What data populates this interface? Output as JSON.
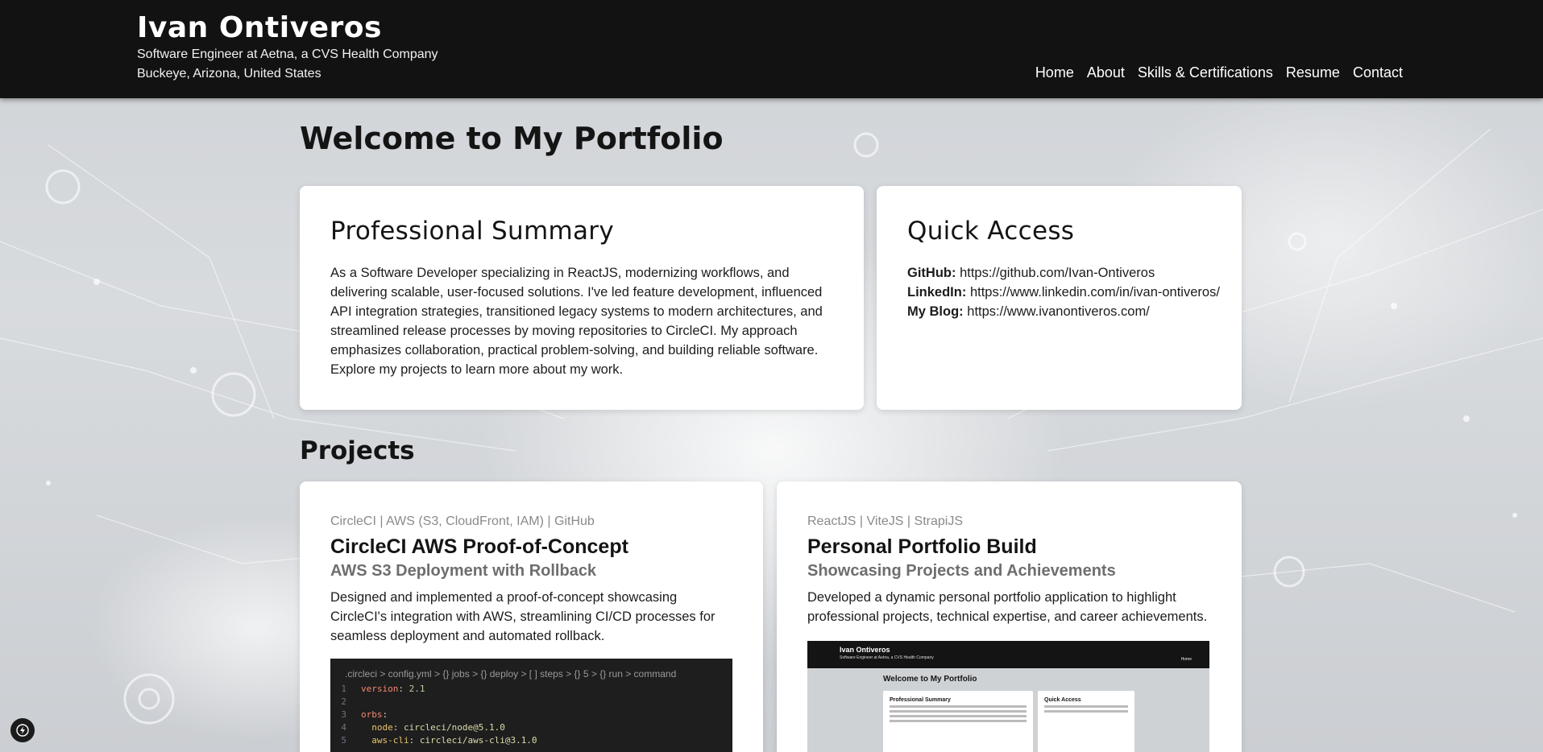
{
  "header": {
    "name": "Ivan Ontiveros",
    "title": "Software Engineer at Aetna, a CVS Health Company",
    "location": "Buckeye, Arizona, United States",
    "nav": [
      "Home",
      "About",
      "Skills & Certifications",
      "Resume",
      "Contact"
    ]
  },
  "welcome": "Welcome to My Portfolio",
  "summary": {
    "heading": "Professional Summary",
    "text": "As a Software Developer specializing in ReactJS, modernizing workflows, and delivering scalable, user-focused solutions. I've led feature development, influenced API integration strategies, transitioned legacy systems to modern architectures, and streamlined release processes by moving repositories to CircleCI. My approach emphasizes collaboration, practical problem-solving, and building reliable software. Explore my projects to learn more about my work."
  },
  "quick_access": {
    "heading": "Quick Access",
    "github_label": "GitHub:",
    "github_url": "https://github.com/Ivan-Ontiveros",
    "linkedin_label": "LinkedIn:",
    "linkedin_url": "https://www.linkedin.com/in/ivan-ontiveros/",
    "blog_label": "My Blog:",
    "blog_url": "https://www.ivanontiveros.com/"
  },
  "projects": {
    "heading": "Projects",
    "items": [
      {
        "tags": "CircleCI | AWS (S3, CloudFront, IAM) | GitHub",
        "title": "CircleCI AWS Proof-of-Concept",
        "subtitle": "AWS S3 Deployment with Rollback",
        "description": "Designed and implemented a proof-of-concept showcasing CircleCI's integration with AWS, streamlining CI/CD processes for seamless deployment and automated rollback.",
        "code_breadcrumb": ".circleci  >  config.yml  >  {} jobs  >  {} deploy  >  [ ] steps  >  {} 5  >  {} run  >  command",
        "code_lines": [
          {
            "num": "1",
            "key": "version",
            "value": "2.1"
          },
          {
            "num": "2",
            "key": "",
            "value": ""
          },
          {
            "num": "3",
            "key": "orbs",
            "value": ""
          },
          {
            "num": "4",
            "key": "node",
            "value": "circleci/node@5.1.0"
          },
          {
            "num": "5",
            "key": "aws-cli",
            "value": "circleci/aws-cli@3.1.0"
          }
        ]
      },
      {
        "tags": "ReactJS | ViteJS | StrapiJS",
        "title": "Personal Portfolio Build",
        "subtitle": "Showcasing Projects and Achievements",
        "description": "Developed a dynamic personal portfolio application to highlight professional projects, technical expertise, and career achievements.",
        "thumb_name": "Ivan Ontiveros",
        "thumb_welcome": "Welcome to My Portfolio",
        "thumb_card1": "Professional Summary",
        "thumb_card2": "Quick Access"
      }
    ]
  },
  "colors": {
    "header_bg": "#121212",
    "card_bg": "#ffffff",
    "tag_gray": "#8a8a8a",
    "subtitle_gray": "#6e6e6e"
  },
  "icons": {
    "floating_button": "lightning-bolt-icon"
  }
}
